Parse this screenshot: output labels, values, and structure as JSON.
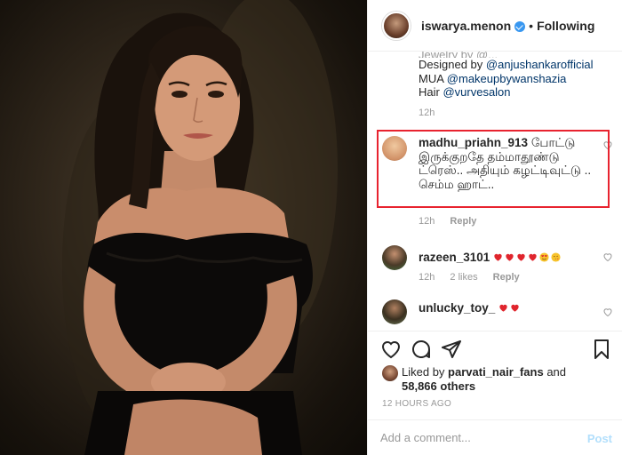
{
  "header": {
    "username": "iswarya.menon",
    "separator": "•",
    "follow_state": "Following"
  },
  "caption": {
    "truncated_line": "Jewelry by @...",
    "lines": [
      {
        "prefix": "Designed by ",
        "mention": "@anjushankarofficial"
      },
      {
        "prefix": "MUA ",
        "mention": "@makeupbywanshazia"
      },
      {
        "prefix": "Hair ",
        "mention": "@vurvesalon"
      }
    ],
    "time": "12h"
  },
  "comments": [
    {
      "username": "madhu_priahn_913",
      "text": "போட்டு இருக்குறதே தம்மாதூண்டு ட்ரெஸ்.. அதியும் கழட்டிவுட்டு .. செம்ம ஹாட்..",
      "time": "12h",
      "reply": "Reply",
      "likes": "",
      "avatar_color": "#e8b890"
    },
    {
      "username": "razeen_3101",
      "text": "",
      "emojis": [
        "heart-red",
        "heart-red",
        "heart-red",
        "heart-red",
        "heart-eyes",
        "kiss-face"
      ],
      "time": "12h",
      "likes": "2 likes",
      "reply": "Reply",
      "avatar_color": "#4a6a3a"
    },
    {
      "username": "unlucky_toy_",
      "text": "",
      "emojis": [
        "heart-red",
        "heart-red"
      ],
      "avatar_color": "#6b7b5a"
    }
  ],
  "likes": {
    "prefix": "Liked by ",
    "liker": "parvati_nair_fans",
    "conjunction": " and",
    "count": "58,866 others"
  },
  "timestamp": "12 HOURS AGO",
  "add_comment": {
    "placeholder": "Add a comment...",
    "post_label": "Post"
  },
  "colors": {
    "highlight_border": "#e8232f",
    "verified": "#3897f0",
    "post_disabled": "#b2dffc",
    "mention": "#003569"
  }
}
